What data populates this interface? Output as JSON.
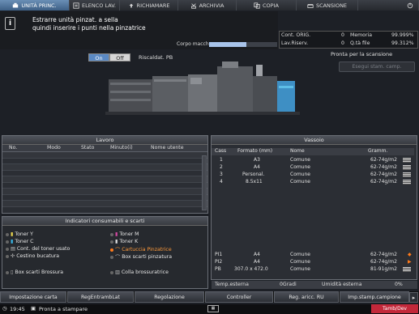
{
  "tabs": [
    {
      "label": "UNITÀ PRINC.",
      "icon": "printer-icon",
      "active": true
    },
    {
      "label": "ELENCO LAV.",
      "icon": "list-icon",
      "active": false
    },
    {
      "label": "RICHIAMARE",
      "icon": "recall-icon",
      "active": false
    },
    {
      "label": "ARCHIVIA",
      "icon": "archive-icon",
      "active": false
    },
    {
      "label": "COPIA",
      "icon": "copy-icon",
      "active": false
    },
    {
      "label": "SCANSIONE",
      "icon": "scan-icon",
      "active": false
    }
  ],
  "message": {
    "line1": "Estrarre unità pinzat. a sella",
    "line2": "quindi inserire i punti nella pinzatrice"
  },
  "memory": {
    "label": "Corpo macch.",
    "fill": 0.55
  },
  "counters": {
    "cont_orig_label": "Cont. ORIG.",
    "cont_orig_value": "0",
    "memoria_label": "Memoria",
    "memoria_value": "99.999%",
    "lav_riserv_label": "Lav.Riserv.",
    "lav_riserv_value": "0",
    "qta_file_label": "Q.tà file",
    "qta_file_value": "99.312%"
  },
  "status": "Pronta per la scansione",
  "sample_button": "Esegui stam. camp.",
  "heater": {
    "on": "On",
    "off": "Off",
    "label": "Riscaldat. PB"
  },
  "lavoro": {
    "title": "Lavoro",
    "columns": [
      "No.",
      "Modo",
      "Stato",
      "Minuto(i)",
      "Nome utente"
    ]
  },
  "consumables": {
    "title": "Indicatori consumabili e scarti",
    "items": [
      {
        "label": "Toner Y",
        "icon": "toner-y-icon",
        "warn": false
      },
      {
        "label": "Toner M",
        "icon": "toner-m-icon",
        "warn": false
      },
      {
        "label": "Toner C",
        "icon": "toner-c-icon",
        "warn": false
      },
      {
        "label": "Toner K",
        "icon": "toner-k-icon",
        "warn": false
      },
      {
        "label": "Cont. del toner usato",
        "icon": "waste-toner-icon",
        "warn": false
      },
      {
        "label": "Cartuccia Pinzatrice",
        "icon": "staple-icon",
        "warn": true
      },
      {
        "label": "Cestino bucatura",
        "icon": "punch-icon",
        "warn": false
      },
      {
        "label": "Box scarti pinzatura",
        "icon": "staple-waste-icon",
        "warn": false
      },
      {
        "label": "Box scarti Brossura",
        "icon": "binding-waste-icon",
        "warn": false
      },
      {
        "label": "Colla brossuratrice",
        "icon": "glue-icon",
        "warn": false
      }
    ]
  },
  "vassoio": {
    "title": "Vassoio",
    "columns": [
      "Cass",
      "Formato (mm)",
      "Nome",
      "Gramm."
    ],
    "rows": [
      {
        "cass": "1",
        "formato": "A3",
        "nome": "Comune",
        "gramm": "62-74g/m2"
      },
      {
        "cass": "2",
        "formato": "A4",
        "nome": "Comune",
        "gramm": "62-74g/m2"
      },
      {
        "cass": "3",
        "formato": "Personal.",
        "nome": "Comune",
        "gramm": "62-74g/m2"
      },
      {
        "cass": "4",
        "formato": "8.5x11",
        "nome": "Comune",
        "gramm": "62-74g/m2"
      }
    ],
    "lower_rows": [
      {
        "cass": "PI1",
        "formato": "A4",
        "nome": "Comune",
        "gramm": "62-74g/m2"
      },
      {
        "cass": "PI2",
        "formato": "A4",
        "nome": "Comune",
        "gramm": "62-74g/m2"
      },
      {
        "cass": "PB",
        "formato": "307.0 x 472.0",
        "nome": "Comune",
        "gramm": "81-91g/m2"
      }
    ]
  },
  "temp": {
    "label": "Temp.esterna",
    "value": "0Gradi",
    "hum_label": "Umidità esterna",
    "hum_value": "0%"
  },
  "bottom_buttons": [
    "Impostazione carta",
    "RegEntrambLat",
    "Regolazione",
    "Controller",
    "Reg. aricc. RU",
    "Imp.stamp.campione"
  ],
  "system": {
    "time": "19:45",
    "status": "Pronta a stampare",
    "user_button": "Tamb/Dev"
  },
  "colors": {
    "active_tab": "#4e77a5",
    "warning": "#ff7a1a"
  }
}
